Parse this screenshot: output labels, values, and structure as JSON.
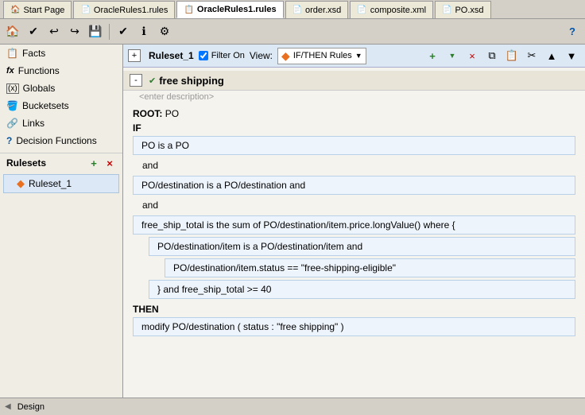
{
  "tabs": [
    {
      "id": "start-page",
      "label": "Start Page",
      "icon": "🏠",
      "active": false
    },
    {
      "id": "oracle-rules-1",
      "label": "OracleRules1.rules",
      "icon": "📄",
      "active": false
    },
    {
      "id": "oracle-rules-main",
      "label": "OracleRules1.rules",
      "icon": "📋",
      "active": true
    },
    {
      "id": "order-xsd",
      "label": "order.xsd",
      "icon": "📄",
      "active": false
    },
    {
      "id": "composite-xml",
      "label": "composite.xml",
      "icon": "📄",
      "active": false
    },
    {
      "id": "po-xsd",
      "label": "PO.xsd",
      "icon": "📄",
      "active": false
    }
  ],
  "toolbar": {
    "buttons": [
      "🏠",
      "✔",
      "↩",
      "↪",
      "💾",
      "✔",
      "ℹ",
      "⚙"
    ]
  },
  "sidebar": {
    "items": [
      {
        "id": "facts",
        "label": "Facts",
        "icon": "📋"
      },
      {
        "id": "functions",
        "label": "Functions",
        "icon": "fx"
      },
      {
        "id": "globals",
        "label": "Globals",
        "icon": "(x)"
      },
      {
        "id": "bucketsets",
        "label": "Bucketsets",
        "icon": "🪣"
      },
      {
        "id": "links",
        "label": "Links",
        "icon": "🔗"
      },
      {
        "id": "decision-functions",
        "label": "Decision Functions",
        "icon": "❓"
      }
    ],
    "rulesets_label": "Rulesets",
    "add_icon": "+",
    "remove_icon": "×",
    "rulesets": [
      {
        "id": "ruleset-1",
        "label": "Ruleset_1"
      }
    ]
  },
  "ruleset_toolbar": {
    "expand_icon": "+",
    "collapse_icon": "-",
    "ruleset_name": "Ruleset_1",
    "filter_label": "Filter On",
    "view_label": "View:",
    "view_option": "IF/THEN Rules",
    "add_rule_label": "+",
    "delete_rule_label": "×"
  },
  "rule": {
    "name": "free shipping",
    "description": "<enter description>",
    "root_label": "ROOT:",
    "root_value": "PO",
    "if_label": "IF",
    "conditions": [
      {
        "id": "c1",
        "text": "PO is a PO",
        "indent": 0
      },
      {
        "id": "and1",
        "type": "and",
        "text": "and",
        "indent": 0
      },
      {
        "id": "c2",
        "text": "PO/destination is a PO/destination  and",
        "indent": 0
      },
      {
        "id": "and2",
        "type": "and",
        "text": "and",
        "indent": 0
      },
      {
        "id": "c3",
        "text": "free_ship_total is the sum of PO/destination/item.price.longValue() where {",
        "indent": 0
      },
      {
        "id": "c4",
        "text": "PO/destination/item is a PO/destination/item  and",
        "indent": 1
      },
      {
        "id": "c5",
        "text": "PO/destination/item.status  ==  \"free-shipping-eligible\"",
        "indent": 2
      },
      {
        "id": "c6",
        "text": "} and  free_ship_total  >=  40",
        "indent": 1
      }
    ],
    "then_label": "THEN",
    "then_actions": [
      {
        "id": "a1",
        "text": "modify PO/destination (  status : \"free shipping\"  )"
      }
    ]
  },
  "status_bar": {
    "icon": "◀",
    "label": "Design"
  }
}
